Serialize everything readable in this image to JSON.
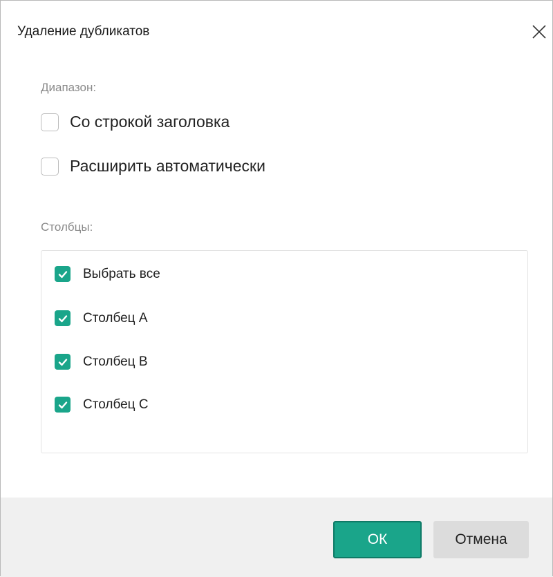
{
  "dialog": {
    "title": "Удаление дубликатов"
  },
  "range": {
    "label": "Диапазон:",
    "options": [
      {
        "label": "Со строкой заголовка",
        "checked": false
      },
      {
        "label": "Расширить автоматически",
        "checked": false
      }
    ]
  },
  "columns": {
    "label": "Столбцы:",
    "items": [
      {
        "label": "Выбрать все",
        "checked": true
      },
      {
        "label": "Столбец А",
        "checked": true
      },
      {
        "label": "Столбец В",
        "checked": true
      },
      {
        "label": "Столбец С",
        "checked": true
      }
    ]
  },
  "footer": {
    "ok_label": "ОК",
    "cancel_label": "Отмена"
  },
  "colors": {
    "accent": "#1aa58a",
    "footer_bg": "#f0f0f0",
    "cancel_bg": "#dcdcdc"
  },
  "icons": {
    "close": "close-icon",
    "check": "checkmark-icon"
  }
}
